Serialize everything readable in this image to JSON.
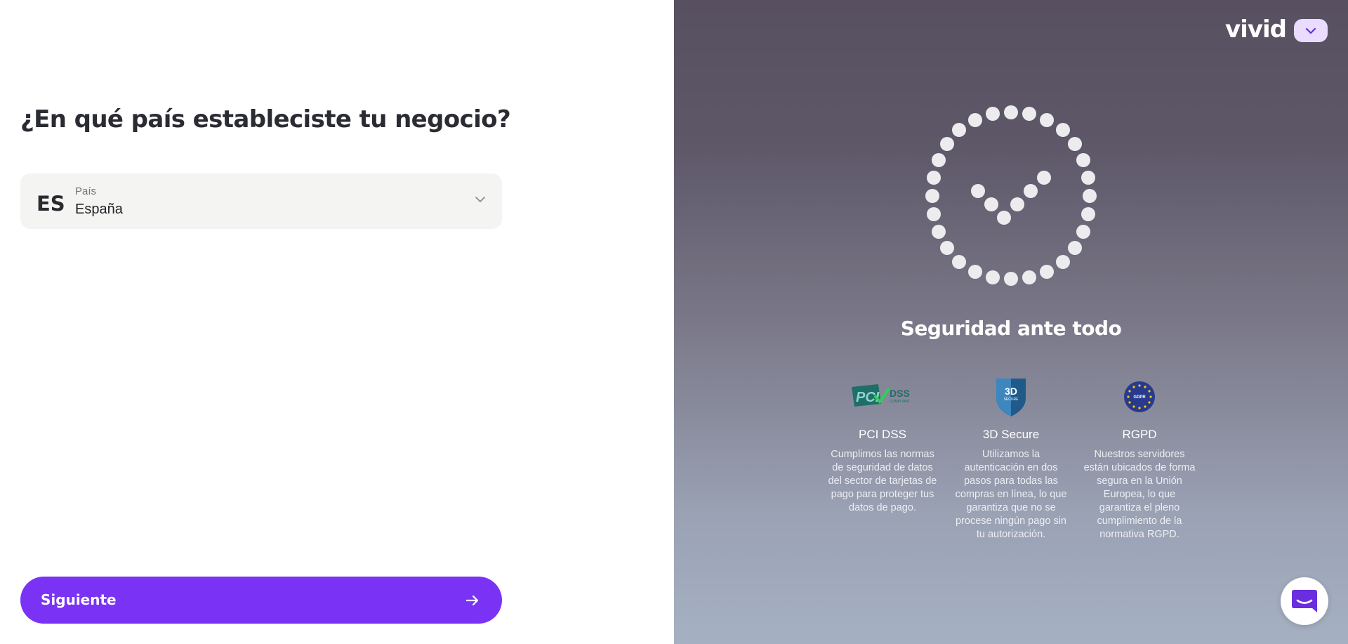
{
  "form": {
    "question": "¿En qué país estableciste tu negocio?",
    "country_field": {
      "code": "ES",
      "label": "País",
      "value": "España"
    },
    "next_label": "Siguiente"
  },
  "brand": {
    "logo": "vivid",
    "accent_color": "#7a33f5"
  },
  "security": {
    "title": "Seguridad ante todo",
    "features": [
      {
        "icon": "pci-dss-icon",
        "logo_text": "PCI DSS COMPLIANT",
        "title": "PCI DSS",
        "text": "Cumplimos las normas de seguridad de datos del sector de tarjetas de pago para proteger tus datos de pago."
      },
      {
        "icon": "3d-secure-icon",
        "logo_text": "3D SECURE",
        "title": "3D Secure",
        "text": "Utilizamos la autenticación en dos pasos para todas las compras en línea, lo que garantiza que no se procese ningún pago sin tu autorización."
      },
      {
        "icon": "gdpr-icon",
        "logo_text": "GDPR",
        "title": "RGPD",
        "text": "Nuestros servidores están ubicados de forma segura en la Unión Europea, lo que garantiza el pleno cumplimiento de la normativa RGPD."
      }
    ]
  },
  "icons": {
    "chevron": "chevron-down-icon",
    "arrow": "arrow-right-icon",
    "language": "chevron-down-icon",
    "security": "dotted-shield-check-icon",
    "chat": "chat-icon"
  }
}
